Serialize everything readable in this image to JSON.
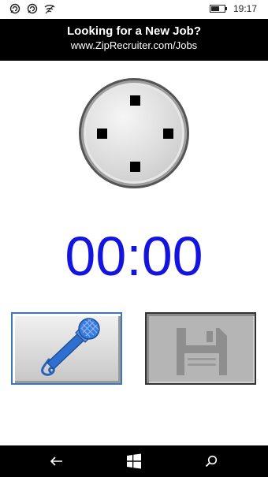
{
  "status_bar": {
    "time": "19:17",
    "icons": [
      "notification-icon",
      "notification-icon",
      "wifi-icon",
      "battery-icon"
    ],
    "battery_level": 0.65
  },
  "ad": {
    "title": "Looking for a New Job?",
    "url": "www.ZipRecruiter.com/Jobs"
  },
  "dial": {
    "icon": "dial-knob"
  },
  "timer": {
    "value": "00:00",
    "color": "#1414e0"
  },
  "buttons": {
    "record": {
      "icon": "microphone-icon",
      "enabled": true
    },
    "save": {
      "icon": "floppy-disk-icon",
      "enabled": false
    }
  },
  "nav_bar": {
    "items": [
      "back-arrow-icon",
      "windows-logo-icon",
      "search-icon"
    ]
  }
}
